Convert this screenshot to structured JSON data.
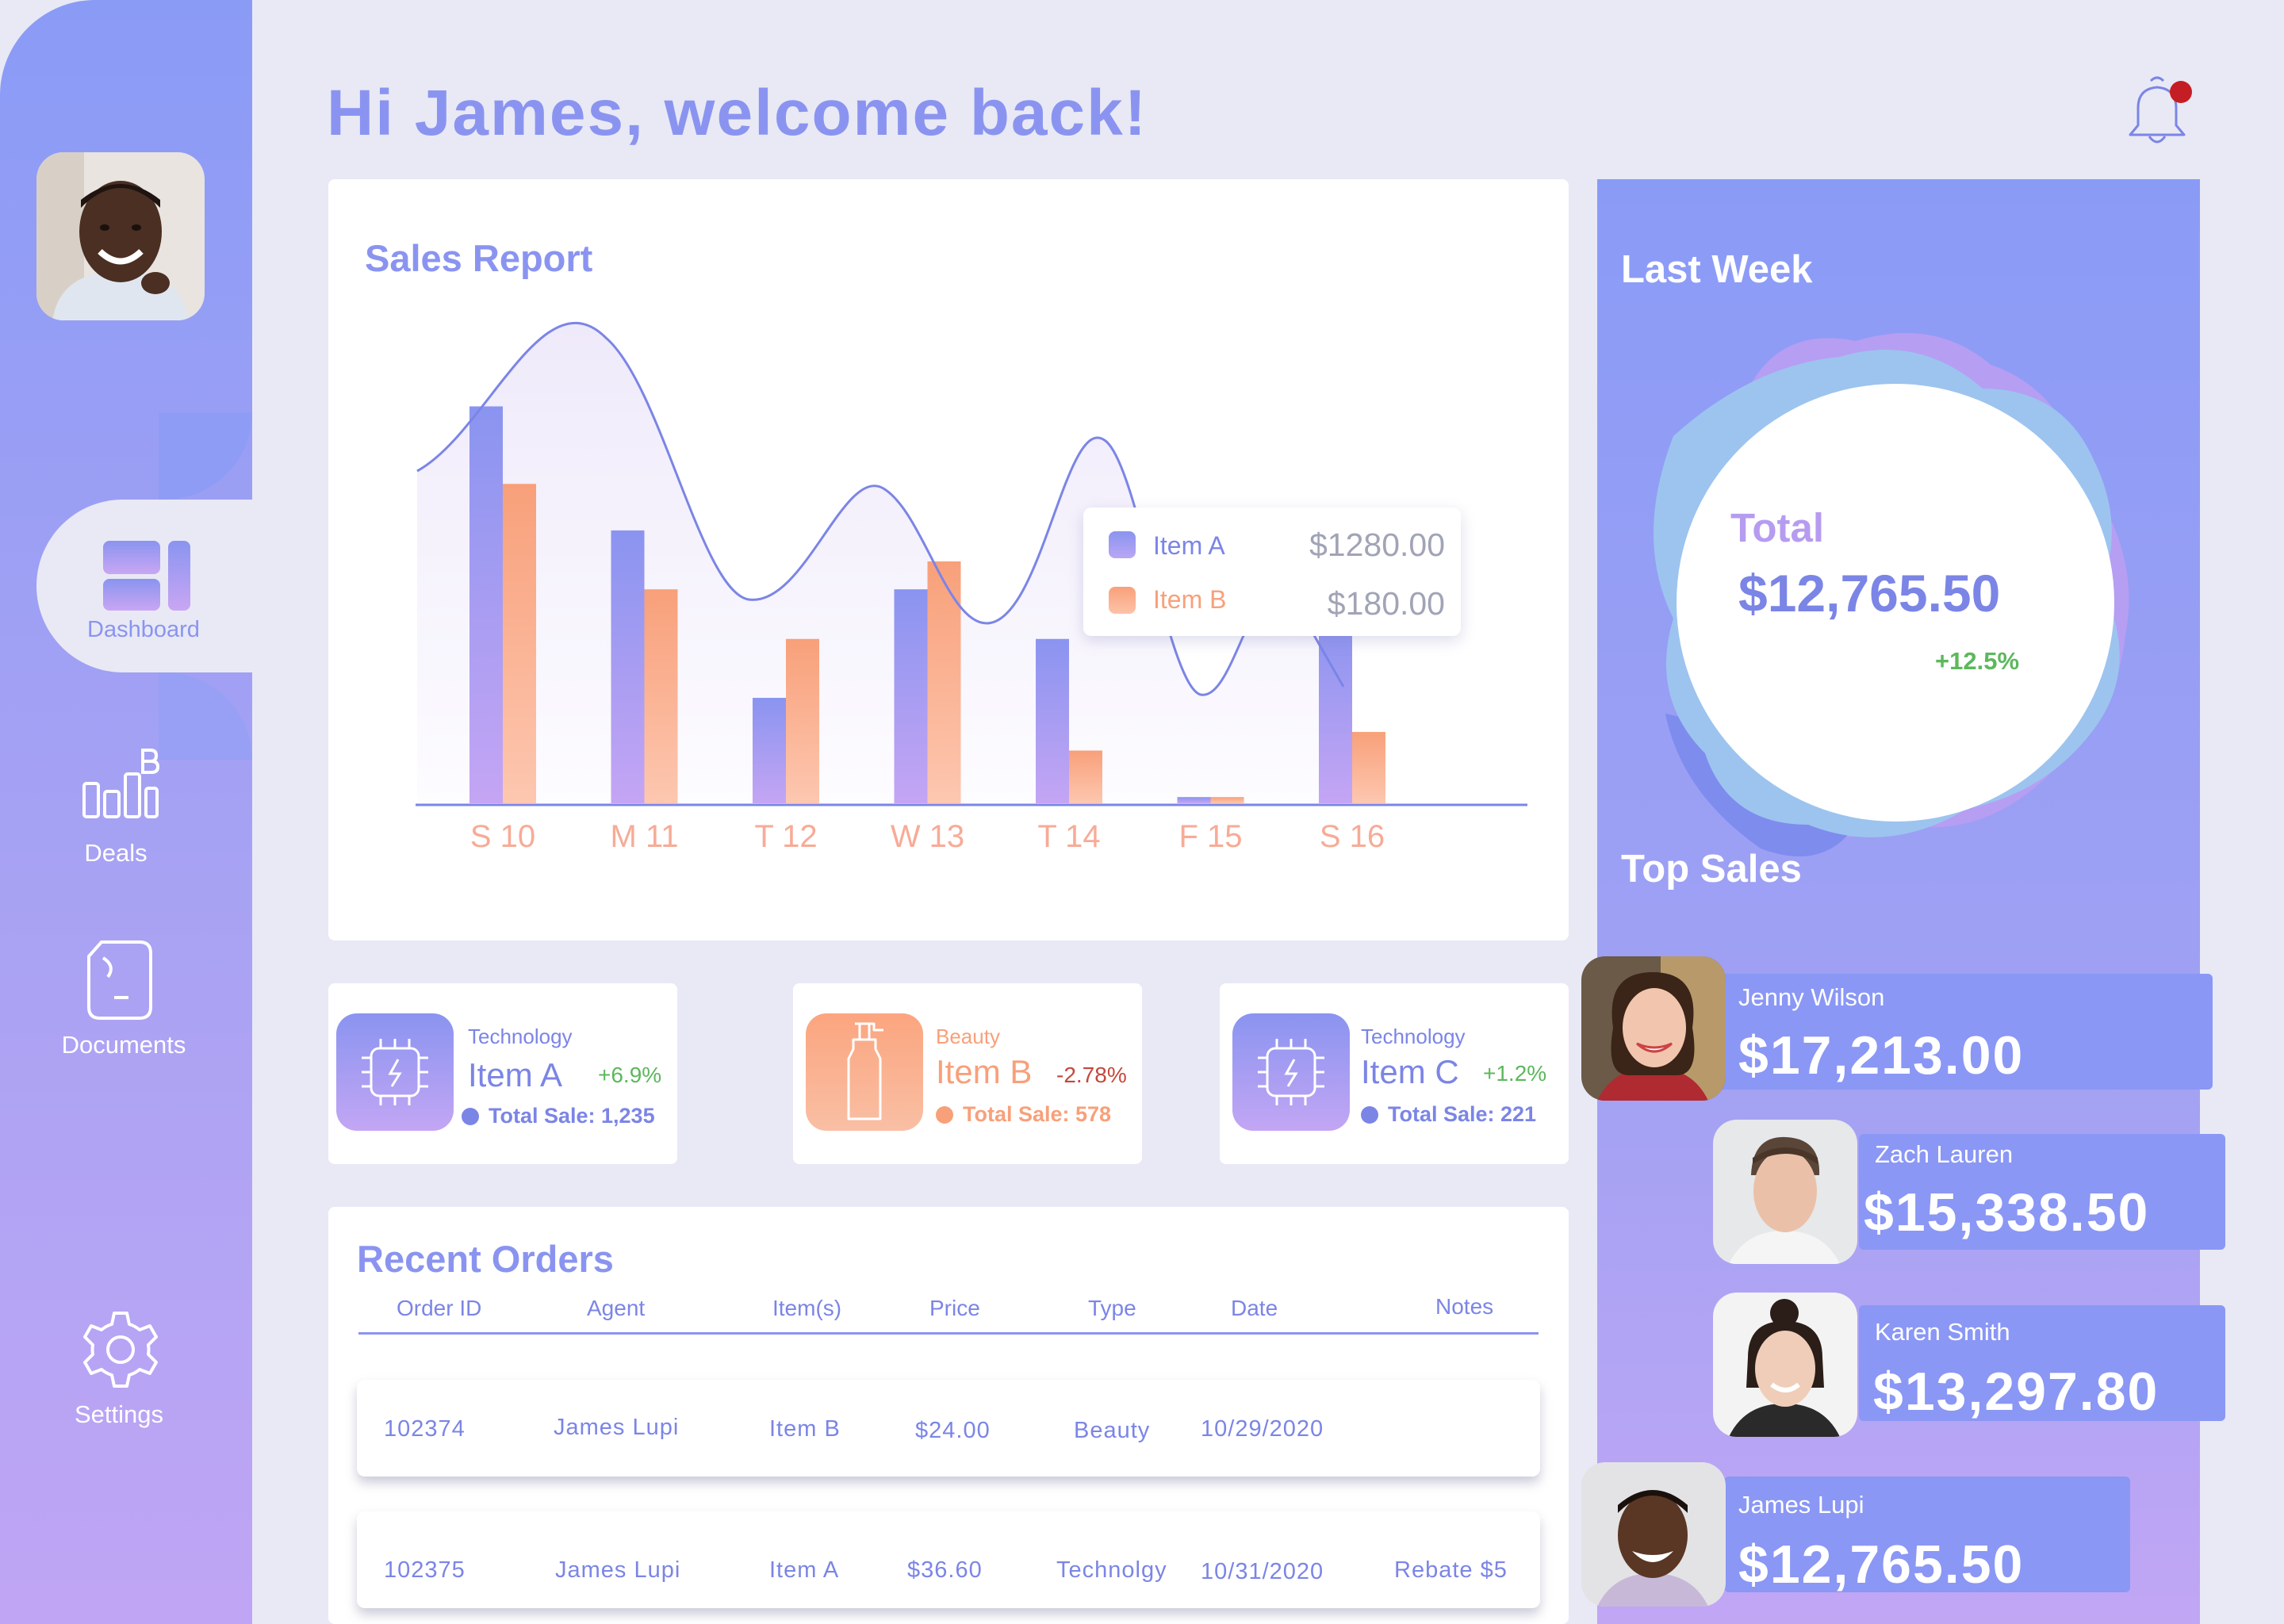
{
  "greeting": "Hi James, welcome back!",
  "sidebar": {
    "items": [
      {
        "label": "Dashboard",
        "icon": "dashboard-icon",
        "active": true
      },
      {
        "label": "Deals",
        "icon": "deals-icon"
      },
      {
        "label": "Documents",
        "icon": "documents-icon"
      },
      {
        "label": "Settings",
        "icon": "settings-icon"
      }
    ]
  },
  "sales_report": {
    "title": "Sales Report",
    "legend": [
      {
        "name": "Item A",
        "value": "$1280.00",
        "color": "#8a94f0"
      },
      {
        "name": "Item B",
        "value": "$180.00",
        "color": "#f8a682"
      }
    ]
  },
  "chart_data": {
    "type": "bar",
    "title": "Sales Report",
    "categories": [
      "S 10",
      "M 11",
      "T 12",
      "W 13",
      "T 14",
      "F 15",
      "S 16"
    ],
    "series": [
      {
        "name": "Item A",
        "values": [
          1280,
          880,
          340,
          690,
          530,
          20,
          600
        ]
      },
      {
        "name": "Item B",
        "values": [
          1030,
          690,
          530,
          780,
          170,
          20,
          230
        ]
      }
    ],
    "ylim": [
      0,
      1450
    ],
    "grid": false
  },
  "items": [
    {
      "category": "Technology",
      "name": "Item A",
      "change": "+6.9%",
      "total": "Total Sale: 1,235",
      "icon": "chip-icon"
    },
    {
      "category": "Beauty",
      "name": "Item B",
      "change": "-2.78%",
      "total": "Total Sale: 578",
      "icon": "bottle-icon"
    },
    {
      "category": "Technology",
      "name": "Item C",
      "change": "+1.2%",
      "total": "Total Sale: 221",
      "icon": "chip-icon"
    }
  ],
  "orders": {
    "title": "Recent Orders",
    "columns": [
      "Order ID",
      "Agent",
      "Item(s)",
      "Price",
      "Type",
      "Date",
      "Notes"
    ],
    "rows": [
      {
        "id": "102374",
        "agent": "James Lupi",
        "item": "Item B",
        "price": "$24.00",
        "type": "Beauty",
        "date": "10/29/2020",
        "notes": ""
      },
      {
        "id": "102375",
        "agent": "James Lupi",
        "item": "Item A",
        "price": "$36.60",
        "type": "Technolgy",
        "date": "10/31/2020",
        "notes": "Rebate $5"
      }
    ]
  },
  "last_week": {
    "title": "Last Week",
    "total_label": "Total",
    "total_value": "$12,765.50",
    "change": "+12.5%"
  },
  "top_sales": {
    "title": "Top Sales",
    "people": [
      {
        "name": "Jenny Wilson",
        "amount": "$17,213.00"
      },
      {
        "name": "Zach Lauren",
        "amount": "$15,338.50"
      },
      {
        "name": "Karen Smith",
        "amount": "$13,297.80"
      },
      {
        "name": "James Lupi",
        "amount": "$12,765.50"
      }
    ]
  }
}
